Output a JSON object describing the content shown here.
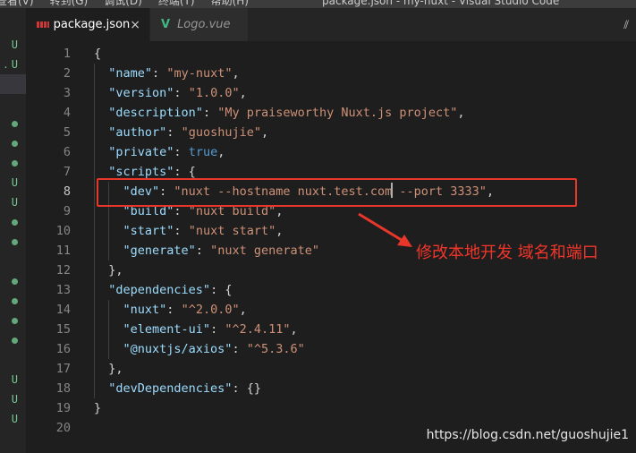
{
  "titlebar": {
    "menu": [
      "查看(V)",
      "转到(G)",
      "调试(D)",
      "终端(T)",
      "帮助(H)"
    ],
    "window_title": "package.json - my-nuxt - Visual Studio Code"
  },
  "tabs": [
    {
      "label": "package.json",
      "icon": "npm-icon",
      "active": true,
      "close": "×"
    },
    {
      "label": "Logo.vue",
      "icon": "vue-icon",
      "active": false
    }
  ],
  "tab_actions": {
    "split_icon": "⫽"
  },
  "sidebar": {
    "rows": [
      {
        "badge": "U",
        "prefix": ""
      },
      {
        "badge": "U",
        "prefix": ".",
        "selected": false
      },
      {
        "badge": "",
        "selected": true
      },
      {
        "badge": ""
      },
      {
        "badge": "dot"
      },
      {
        "badge": "dot"
      },
      {
        "badge": "dot"
      },
      {
        "badge": "U"
      },
      {
        "badge": "U"
      },
      {
        "badge": "dot"
      },
      {
        "badge": "dot"
      },
      {
        "badge": ""
      },
      {
        "badge": "dot"
      },
      {
        "badge": "dot"
      },
      {
        "badge": "dot"
      },
      {
        "badge": "dot"
      },
      {
        "badge": ""
      },
      {
        "badge": "U"
      },
      {
        "badge": "U"
      },
      {
        "badge": "U"
      }
    ]
  },
  "editor": {
    "current_line": 8,
    "line_numbers": [
      "1",
      "2",
      "3",
      "4",
      "5",
      "6",
      "7",
      "8",
      "9",
      "10",
      "11",
      "12",
      "13",
      "14",
      "15",
      "16",
      "17",
      "18",
      "19",
      "20"
    ],
    "lines": [
      {
        "indent": 0,
        "tokens": [
          {
            "t": "p",
            "v": "{"
          }
        ]
      },
      {
        "indent": 1,
        "tokens": [
          {
            "t": "k",
            "v": "\"name\""
          },
          {
            "t": "p",
            "v": ": "
          },
          {
            "t": "s",
            "v": "\"my-nuxt\""
          },
          {
            "t": "p",
            "v": ","
          }
        ]
      },
      {
        "indent": 1,
        "tokens": [
          {
            "t": "k",
            "v": "\"version\""
          },
          {
            "t": "p",
            "v": ": "
          },
          {
            "t": "s",
            "v": "\"1.0.0\""
          },
          {
            "t": "p",
            "v": ","
          }
        ]
      },
      {
        "indent": 1,
        "tokens": [
          {
            "t": "k",
            "v": "\"description\""
          },
          {
            "t": "p",
            "v": ": "
          },
          {
            "t": "s",
            "v": "\"My praiseworthy Nuxt.js project\""
          },
          {
            "t": "p",
            "v": ","
          }
        ]
      },
      {
        "indent": 1,
        "tokens": [
          {
            "t": "k",
            "v": "\"author\""
          },
          {
            "t": "p",
            "v": ": "
          },
          {
            "t": "s",
            "v": "\"guoshujie\""
          },
          {
            "t": "p",
            "v": ","
          }
        ]
      },
      {
        "indent": 1,
        "tokens": [
          {
            "t": "k",
            "v": "\"private\""
          },
          {
            "t": "p",
            "v": ": "
          },
          {
            "t": "b",
            "v": "true"
          },
          {
            "t": "p",
            "v": ","
          }
        ]
      },
      {
        "indent": 1,
        "tokens": [
          {
            "t": "k",
            "v": "\"scripts\""
          },
          {
            "t": "p",
            "v": ": {"
          }
        ]
      },
      {
        "indent": 2,
        "tokens": [
          {
            "t": "k",
            "v": "\"dev\""
          },
          {
            "t": "p",
            "v": ": "
          },
          {
            "t": "s",
            "v": "\"nuxt --hostname nuxt.test.com"
          },
          {
            "t": "cursor"
          },
          {
            "t": "s",
            "v": " --port 3333\""
          },
          {
            "t": "p",
            "v": ","
          }
        ]
      },
      {
        "indent": 2,
        "tokens": [
          {
            "t": "k",
            "v": "\"build\""
          },
          {
            "t": "p",
            "v": ": "
          },
          {
            "t": "s",
            "v": "\"nuxt build\""
          },
          {
            "t": "p",
            "v": ","
          }
        ]
      },
      {
        "indent": 2,
        "tokens": [
          {
            "t": "k",
            "v": "\"start\""
          },
          {
            "t": "p",
            "v": ": "
          },
          {
            "t": "s",
            "v": "\"nuxt start\""
          },
          {
            "t": "p",
            "v": ","
          }
        ]
      },
      {
        "indent": 2,
        "tokens": [
          {
            "t": "k",
            "v": "\"generate\""
          },
          {
            "t": "p",
            "v": ": "
          },
          {
            "t": "s",
            "v": "\"nuxt generate\""
          }
        ]
      },
      {
        "indent": 1,
        "tokens": [
          {
            "t": "p",
            "v": "},"
          }
        ]
      },
      {
        "indent": 1,
        "tokens": [
          {
            "t": "k",
            "v": "\"dependencies\""
          },
          {
            "t": "p",
            "v": ": {"
          }
        ]
      },
      {
        "indent": 2,
        "tokens": [
          {
            "t": "k",
            "v": "\"nuxt\""
          },
          {
            "t": "p",
            "v": ": "
          },
          {
            "t": "s",
            "v": "\"^2.0.0\""
          },
          {
            "t": "p",
            "v": ","
          }
        ]
      },
      {
        "indent": 2,
        "tokens": [
          {
            "t": "k",
            "v": "\"element-ui\""
          },
          {
            "t": "p",
            "v": ": "
          },
          {
            "t": "s",
            "v": "\"^2.4.11\""
          },
          {
            "t": "p",
            "v": ","
          }
        ]
      },
      {
        "indent": 2,
        "tokens": [
          {
            "t": "k",
            "v": "\"@nuxtjs/axios\""
          },
          {
            "t": "p",
            "v": ": "
          },
          {
            "t": "s",
            "v": "\"^5.3.6\""
          }
        ]
      },
      {
        "indent": 1,
        "tokens": [
          {
            "t": "p",
            "v": "},"
          }
        ]
      },
      {
        "indent": 1,
        "tokens": [
          {
            "t": "k",
            "v": "\"devDependencies\""
          },
          {
            "t": "p",
            "v": ": {}"
          }
        ]
      },
      {
        "indent": 0,
        "tokens": [
          {
            "t": "p",
            "v": "}"
          }
        ]
      },
      {
        "indent": 0,
        "tokens": []
      }
    ]
  },
  "annotation": {
    "note": "修改本地开发 域名和端口",
    "color": "#e8372a"
  },
  "watermark": "https://blog.csdn.net/guoshujie1"
}
